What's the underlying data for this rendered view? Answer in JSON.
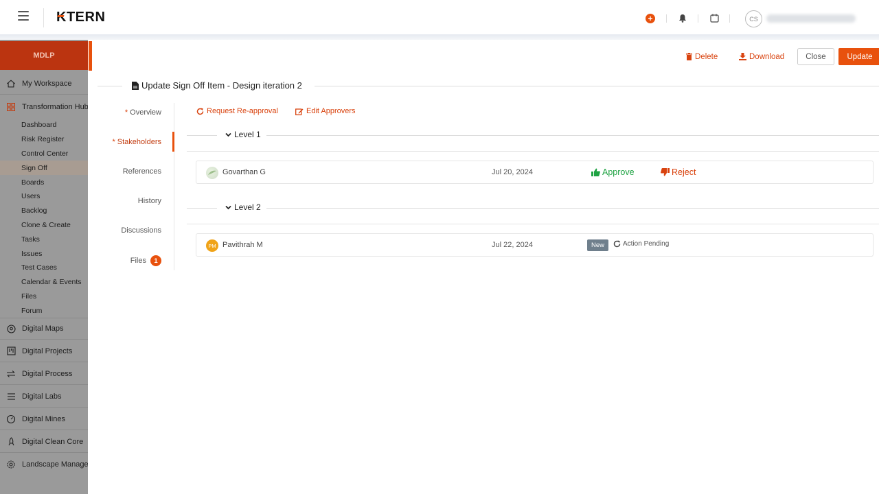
{
  "app": {
    "logo_text": "TERN",
    "logo_initial": "K",
    "user_initials": "CS"
  },
  "colors": {
    "accent": "#e8510d",
    "sidebar_bg": "#9a9a9a",
    "sidebar_header": "#bb3410",
    "approve": "#1fa343",
    "badge_new": "#6f7f8c"
  },
  "sidebar": {
    "header": "MDLP",
    "items": [
      {
        "label": "My Workspace",
        "icon": "home-icon"
      },
      {
        "label": "Transformation Hub",
        "icon": "grid-icon"
      },
      {
        "label": "Digital Maps",
        "icon": "map-pin-icon"
      },
      {
        "label": "Digital Projects",
        "icon": "kanban-icon"
      },
      {
        "label": "Digital Process",
        "icon": "arrows-icon"
      },
      {
        "label": "Digital Labs",
        "icon": "list-icon"
      },
      {
        "label": "Digital Mines",
        "icon": "gauge-icon"
      },
      {
        "label": "Digital Clean Core",
        "icon": "rocket-icon"
      },
      {
        "label": "Landscape Managem",
        "icon": "gear-icon"
      }
    ],
    "sub_items": [
      "Dashboard",
      "Risk Register",
      "Control Center",
      "Sign Off",
      "Boards",
      "Users",
      "Backlog",
      "Clone & Create",
      "Tasks",
      "Issues",
      "Test Cases",
      "Calendar & Events",
      "Files",
      "Forum"
    ],
    "active_sub": "Sign Off"
  },
  "toolbar": {
    "delete_label": "Delete",
    "download_label": "Download",
    "close_label": "Close",
    "update_label": "Update"
  },
  "page": {
    "title": "Update Sign Off Item - Design iteration 2"
  },
  "tabs": [
    {
      "label": "Overview",
      "required": true
    },
    {
      "label": "Stakeholders",
      "required": true,
      "active": true
    },
    {
      "label": "References",
      "required": false
    },
    {
      "label": "History",
      "required": false
    },
    {
      "label": "Discussions",
      "required": false
    },
    {
      "label": "Files",
      "required": false,
      "badge": "1"
    }
  ],
  "required_marker": "* ",
  "stakeholders": {
    "request_reapproval_label": "Request Re-approval",
    "edit_approvers_label": "Edit Approvers",
    "levels": [
      {
        "label": "Level 1",
        "approvers": [
          {
            "name": "Govarthan G",
            "date": "Jul 20, 2024",
            "approve_label": "Approve",
            "reject_label": "Reject"
          }
        ]
      },
      {
        "label": "Level 2",
        "approvers": [
          {
            "name": "Pavithrah M",
            "initials": "PM",
            "date": "Jul 22, 2024",
            "badge": "New",
            "status": "Action Pending"
          }
        ]
      }
    ]
  }
}
